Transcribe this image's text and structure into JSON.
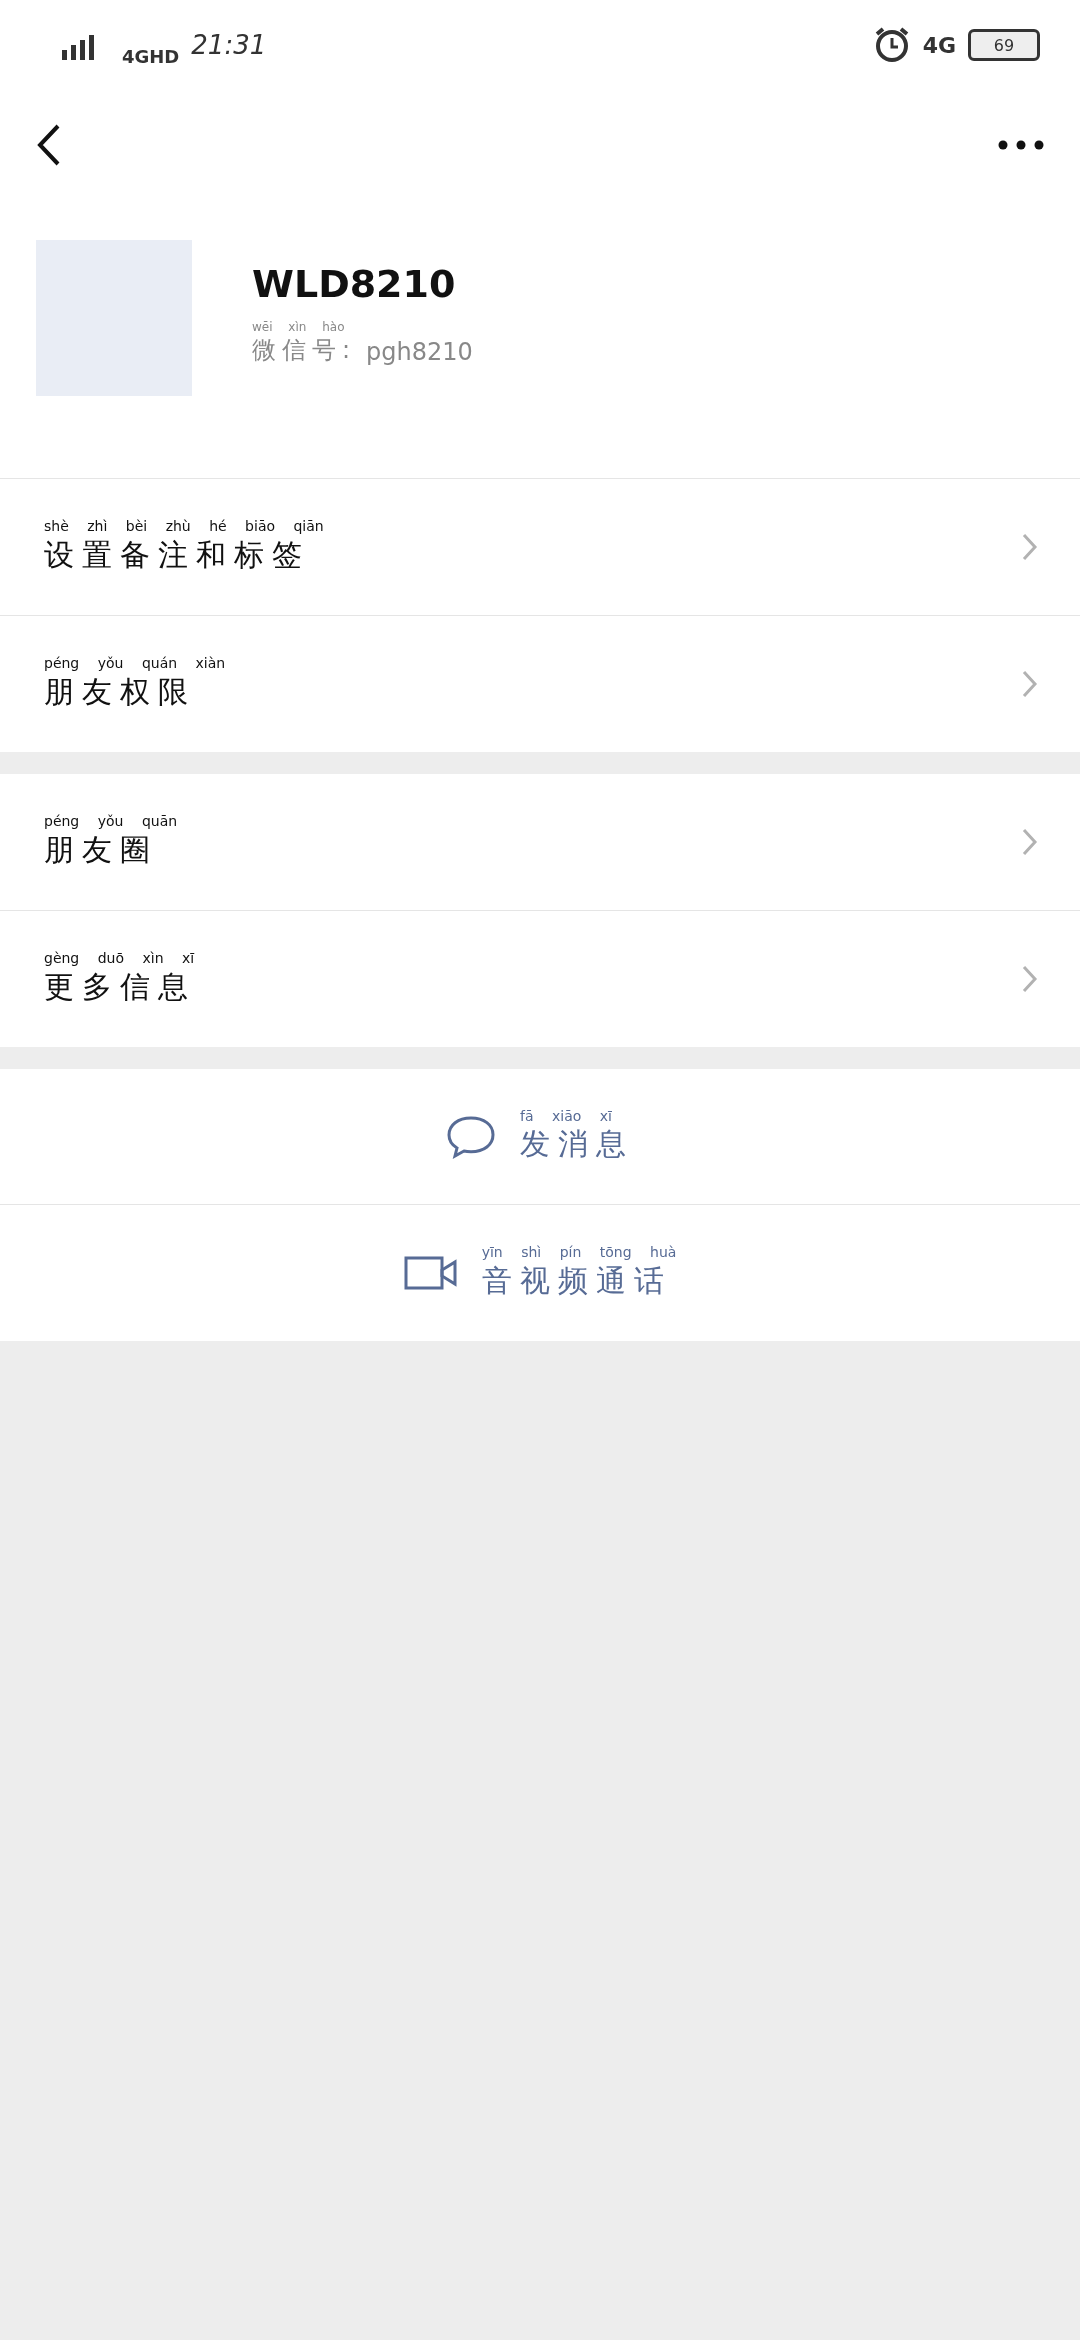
{
  "status_bar": {
    "network": "4GHD",
    "time": "21:31",
    "network_right": "4G",
    "battery": "69"
  },
  "profile": {
    "name": "WLD8210",
    "id_label": {
      "text": "微信号:",
      "pinyin": "wēi xìn hào"
    },
    "id_value": "pgh8210"
  },
  "sections": [
    {
      "items": [
        {
          "text": "设置备注和标签",
          "pinyin": "shè zhì bèi zhù hé biāo qiān"
        },
        {
          "text": "朋友权限",
          "pinyin": "péng yǒu quán xiàn"
        }
      ]
    },
    {
      "items": [
        {
          "text": "朋友圈",
          "pinyin": "péng yǒu quān"
        },
        {
          "text": "更多信息",
          "pinyin": "gèng duō xìn xī"
        }
      ]
    }
  ],
  "actions": [
    {
      "kind": "message",
      "text": "发消息",
      "pinyin": "fā xiāo xī"
    },
    {
      "kind": "video",
      "text": "音视频通话",
      "pinyin": "yīn shì pín tōng huà"
    }
  ]
}
